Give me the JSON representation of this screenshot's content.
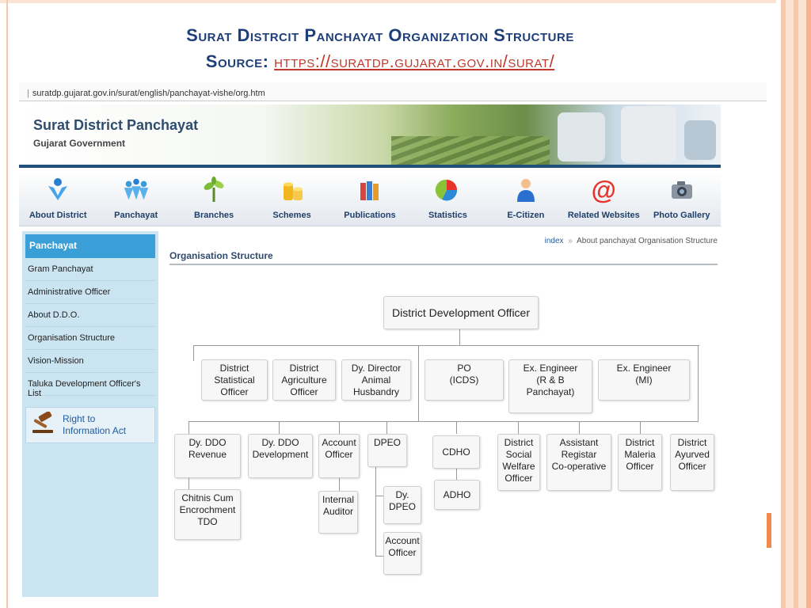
{
  "slide": {
    "title": "Surat Distrcit Panchayat Organization Structure",
    "source_label": "Source:",
    "source_url": "https://suratdp.gujarat.gov.in/surat/"
  },
  "browser": {
    "url": "suratdp.gujarat.gov.in/surat/english/panchayat-vishe/org.htm"
  },
  "site": {
    "name": "Surat District Panchayat",
    "subtitle": "Gujarat Government"
  },
  "nav": [
    {
      "label": "About District",
      "icon": "people-icon"
    },
    {
      "label": "Panchayat",
      "icon": "group-icon"
    },
    {
      "label": "Branches",
      "icon": "plant-icon"
    },
    {
      "label": "Schemes",
      "icon": "coins-icon"
    },
    {
      "label": "Publications",
      "icon": "books-icon"
    },
    {
      "label": "Statistics",
      "icon": "chart-icon"
    },
    {
      "label": "E-Citizen",
      "icon": "person-icon"
    },
    {
      "label": "Related Websites",
      "icon": "at-icon"
    },
    {
      "label": "Photo Gallery",
      "icon": "camera-icon"
    }
  ],
  "sidebar": {
    "heading": "Panchayat",
    "items": [
      {
        "label": "Gram Panchayat"
      },
      {
        "label": "Administrative Officer"
      },
      {
        "label": "About D.D.O."
      },
      {
        "label": "Organisation Structure"
      },
      {
        "label": "Vision-Mission"
      },
      {
        "label": "Taluka Development Officer's List"
      }
    ],
    "rti": {
      "line1": "Right to",
      "line2": "Information Act"
    }
  },
  "breadcrumb": {
    "home": "index",
    "separator": "»",
    "current": "About panchayat Organisation Structure"
  },
  "content": {
    "title": "Organisation Structure"
  },
  "org_chart": {
    "top": "District Development Officer",
    "row1": [
      "District\nStatistical\nOfficer",
      "District\nAgriculture\nOfficer",
      "Dy. Director\nAnimal\nHusbandry",
      "PO\n(ICDS)",
      "Ex. Engineer\n(R & B\nPanchayat)",
      "Ex. Engineer\n(MI)"
    ],
    "row2": [
      "Dy. DDO\nRevenue",
      "Dy. DDO\nDevelopment",
      "Account\nOfficer",
      "DPEO",
      "CDHO",
      "District\nSocial\nWelfare\nOfficer",
      "Assistant\nRegistar\nCo-operative",
      "District\nMaleria\nOfficer",
      "District\nAyurved\nOfficer"
    ],
    "sub": {
      "revenue_child": "Chitnis Cum\nEncrochment\nTDO",
      "account_child": "Internal\nAuditor",
      "dpeo_children": [
        "Dy.\nDPEO",
        "Account\nOfficer"
      ],
      "cdho_child": "ADHO"
    }
  }
}
